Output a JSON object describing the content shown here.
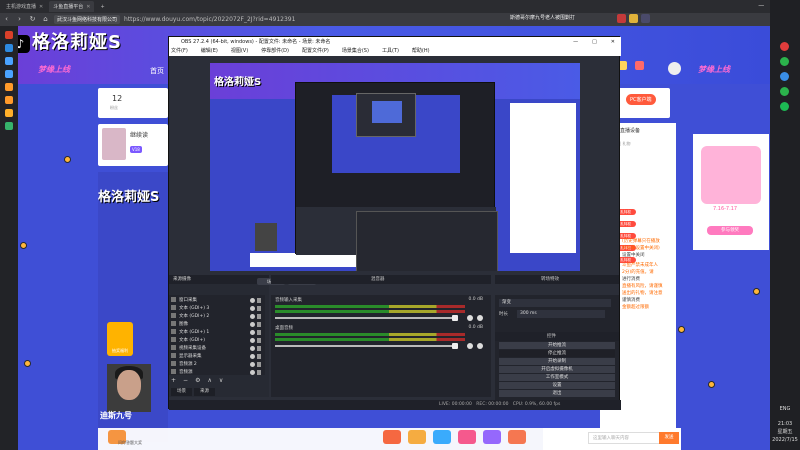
{
  "browser": {
    "tabs": [
      {
        "label": "主机游戏直播",
        "active": false
      },
      {
        "label": "斗鱼直播平台",
        "active": true
      },
      {
        "label": "+",
        "active": false
      }
    ],
    "site_badge": "武汉斗鱼网络科技有限公司",
    "url": "https://www.douyu.com/topic/2022072F_2J?rid=4912391",
    "notification": "斯德哥尔摩九号老人被围剿打",
    "window_controls": [
      "—",
      "□",
      "✕"
    ],
    "colors": {
      "chrome": "#2b2c30",
      "address": "#3a3b40"
    }
  },
  "page": {
    "logo": "格洛莉娅S",
    "logo_icon": "tiktok-icon",
    "brand_left": "梦缘上线",
    "home_link": "首页",
    "brand_right": "梦缘上线",
    "card_left": {
      "count": "12",
      "sub": "粉丝"
    },
    "streamer": {
      "name": "继续读",
      "tag": "V18"
    },
    "video_logo": "格洛莉娅S",
    "gift_label": "抽奖福利",
    "video_name": "迪斯九号",
    "bottom_hint": "问你答题大奖",
    "pc_button": "PC客户端",
    "right_panel": {
      "title": "直播设备",
      "tabs": "贡献  粉丝  礼物",
      "badges": [
        "送礼特权",
        "送礼特权",
        "送礼特权",
        "送礼特权",
        "送礼特权"
      ],
      "orange_lines": [
        "(历史弹幕只在播放",
        "时屏蔽设置中关闭)",
        "斗鱼严禁未成年人",
        "2分)的充值。请",
        "直播有风险，请谨慎",
        "送出的礼物，请注意",
        "金额超过限额"
      ],
      "dark_lines": [
        "设置中关闭",
        "进行消费",
        "谨慎消费"
      ]
    },
    "promo": {
      "date": "7.16-7.17",
      "button": "参与领奖"
    },
    "chat": {
      "placeholder": "这里输入聊天内容",
      "send": "发送"
    }
  },
  "obs": {
    "title": "OBS 27.2.4 (64-bit, windows) - 配置文件: 未命名 - 场景: 未命名",
    "window_controls": [
      "—",
      "□",
      "✕"
    ],
    "menu": [
      "文件(F)",
      "编辑(E)",
      "视图(V)",
      "停靠部件(D)",
      "配置文件(P)",
      "场景集合(S)",
      "工具(T)",
      "帮助(H)"
    ],
    "preview_logo": "格洛莉娅S",
    "scenes_header": "来源摄像",
    "scene_buttons": [
      "场景",
      "场景"
    ],
    "sources": [
      {
        "name": "窗口采集",
        "icon": "window-icon"
      },
      {
        "name": "文本 (GDI+) 3",
        "icon": "text-icon"
      },
      {
        "name": "文本 (GDI+) 2",
        "icon": "text-icon"
      },
      {
        "name": "图像",
        "icon": "image-icon"
      },
      {
        "name": "文本 (GDI+) 1",
        "icon": "text-icon"
      },
      {
        "name": "文本 (GDI+)",
        "icon": "text-icon"
      },
      {
        "name": "视频采集设备",
        "icon": "camera-icon"
      },
      {
        "name": "显示器采集",
        "icon": "monitor-icon"
      },
      {
        "name": "音频源 2",
        "icon": "audio-icon"
      },
      {
        "name": "音频源",
        "icon": "audio-icon"
      }
    ],
    "source_tools": [
      "+",
      "−",
      "⚙",
      "∧",
      "∨"
    ],
    "bottom_tabs": [
      "场景",
      "来源"
    ],
    "mixer_header": "混音器",
    "tracks": [
      {
        "name": "音频输入采集",
        "db": "0.0 dB"
      },
      {
        "name": "桌面音频",
        "db": "0.0 dB"
      }
    ],
    "transitions_header": "转场特效",
    "transition": {
      "type": "渐变",
      "duration_label": "时长",
      "duration": "300 ms"
    },
    "controls_header": "控件",
    "controls": [
      {
        "label": "开始推流",
        "active": false
      },
      {
        "label": "停止推流",
        "active": true
      },
      {
        "label": "开始录制",
        "active": false
      },
      {
        "label": "开启虚拟摄像机",
        "active": false
      },
      {
        "label": "工作室模式",
        "active": false
      },
      {
        "label": "设置",
        "active": false
      },
      {
        "label": "退出",
        "active": false
      }
    ],
    "status": {
      "live": "LIVE: 00:00:00",
      "rec": "REC: 00:00:00",
      "cpu": "CPU: 0.9%, 60.00 fps"
    }
  },
  "taskbar": {
    "lang": "ENG",
    "time": "21:03",
    "weekday": "星期五",
    "date": "2022/7/15"
  }
}
